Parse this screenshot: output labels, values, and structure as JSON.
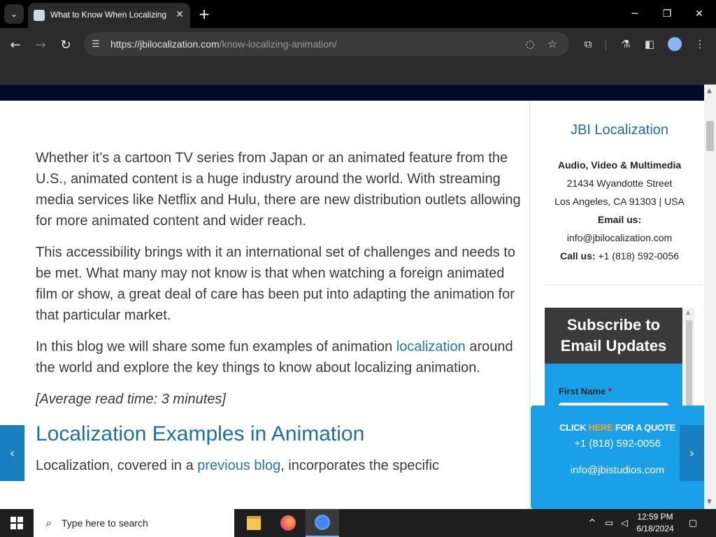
{
  "browser": {
    "tab_title": "What to Know When Localizing",
    "url_host": "https://jbilocalization.com",
    "url_path": "/know-localizing-animation/"
  },
  "article": {
    "para1": "Whether it’s a cartoon TV series from Japan or an animated feature from the U.S., animated content is a huge industry around the world. With streaming media services like Netflix and Hulu, there are new distribution outlets allowing for more animated content and wider reach.",
    "para2": "This accessibility brings with it an international set of challenges and needs to be met. What many may not know is that when watching a foreign animated film or show, a great deal of care has been put into adapting the animation for that particular market.",
    "para3_before": "In this blog we will share some fun examples of animation ",
    "para3_link": "localization",
    "para3_after": " around the world and explore the key things to know about localizing animation.",
    "read_time": "[Average read time: 3 minutes]",
    "heading": "Localization Examples in Animation",
    "para4_before": "Localization, covered in a ",
    "para4_link": "previous blog",
    "para4_after": ", incorporates the specific"
  },
  "sidebar": {
    "title": "JBI Localization",
    "dept": "Audio, Video & Multimedia",
    "street": "21434 Wyandotte Street",
    "city": "Los Angeles, CA 91303 | USA",
    "email_label": "Email us:",
    "email": "info@jbilocalization.com",
    "call_label": "Call us:",
    "phone": "+1 (818) 592-0056"
  },
  "subscribe": {
    "heading": "Subscribe to Email Updates",
    "first_name_label": "First Name",
    "required_mark": "*"
  },
  "quote": {
    "click": "CLICK ",
    "here": "HERE",
    "rest": " FOR A QUOTE",
    "phone": "+1 (818) 592-0056",
    "email": "info@jbistudios.com"
  },
  "taskbar": {
    "search_placeholder": "Type here to search",
    "time": "12:59 PM",
    "date": "6/18/2024"
  },
  "colors": {
    "accent_blue": "#1aa0e8",
    "link_blue": "#1f77b4",
    "navbar_dark": "#020a2a"
  }
}
